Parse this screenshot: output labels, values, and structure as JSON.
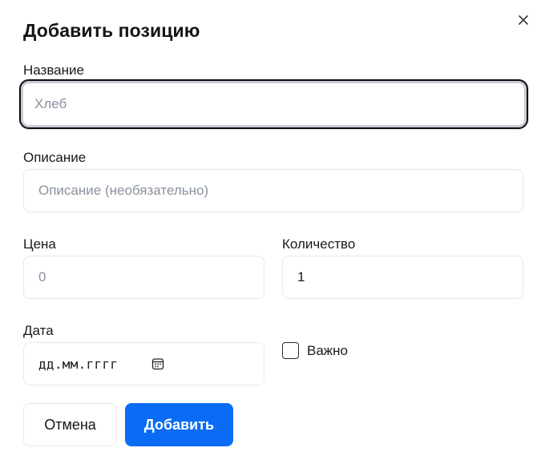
{
  "dialog": {
    "title": "Добавить позицию",
    "close_glyph": "×"
  },
  "fields": {
    "name": {
      "label": "Название",
      "placeholder": "Хлеб",
      "value": ""
    },
    "description": {
      "label": "Описание",
      "placeholder": "Описание (необязательно)",
      "value": ""
    },
    "price": {
      "label": "Цена",
      "placeholder": "0",
      "value": ""
    },
    "quantity": {
      "label": "Количество",
      "value": "1"
    },
    "date": {
      "label": "Дата",
      "placeholder": "дд.мм.гггг"
    },
    "important": {
      "label": "Важно",
      "checked": false
    }
  },
  "buttons": {
    "cancel": "Отмена",
    "add": "Добавить"
  },
  "colors": {
    "primary": "#0a6cf5",
    "border": "#e6e8ec",
    "placeholder": "#8a929e",
    "focus_border": "#0d0f14"
  },
  "icons": {
    "close": "close-icon",
    "date": "calendar-icon"
  }
}
